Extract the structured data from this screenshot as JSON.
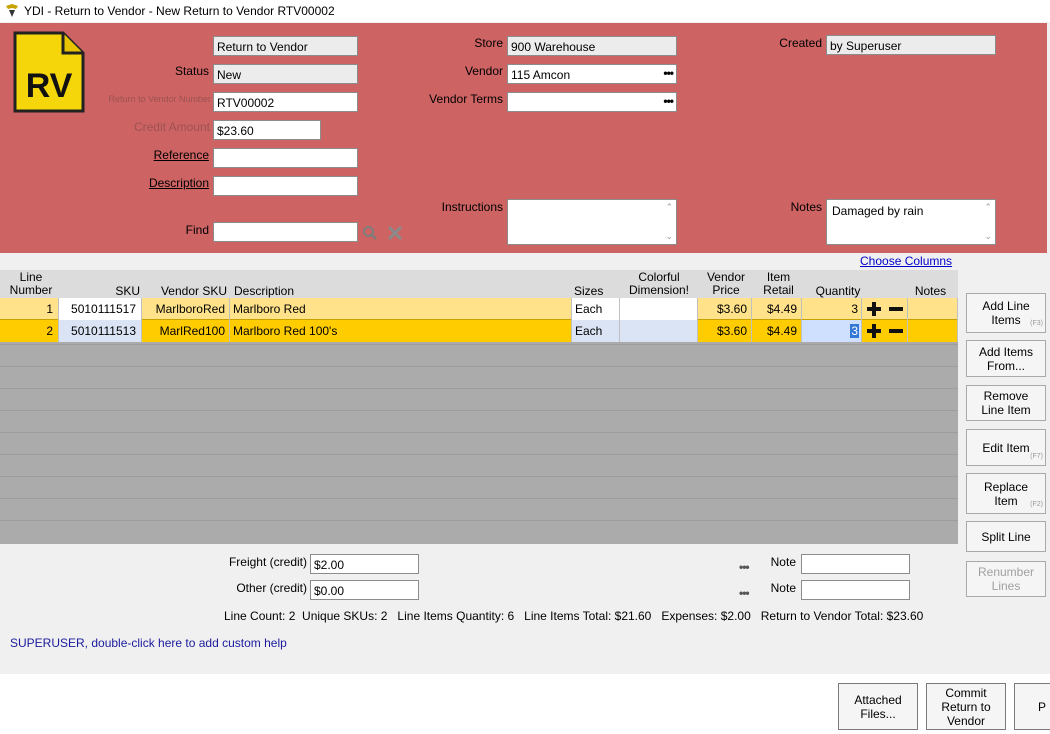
{
  "window": {
    "title": "YDI - Return to Vendor - New Return to Vendor RTV00002"
  },
  "header": {
    "type_value": "Return to Vendor",
    "status_label": "Status",
    "status_value": "New",
    "rtv_number_label": "Return to Vendor Number",
    "rtv_number_value": "RTV00002",
    "credit_amount_label": "Credit Amount",
    "credit_amount_value": "$23.60",
    "reference_label": "Reference",
    "reference_value": "",
    "description_label": "Description",
    "description_value": "",
    "find_label": "Find",
    "find_value": "",
    "store_label": "Store",
    "store_value": "900 Warehouse",
    "vendor_label": "Vendor",
    "vendor_value": "115 Amcon",
    "vendor_terms_label": "Vendor Terms",
    "vendor_terms_value": "",
    "instructions_label": "Instructions",
    "instructions_value": "",
    "created_label": "Created",
    "created_value": "by Superuser",
    "notes_label": "Notes",
    "notes_value": "Damaged by rain",
    "logo_text": "RV",
    "ellipsis": "•••"
  },
  "grid": {
    "choose_columns": "Choose Columns",
    "columns": {
      "line_number": "Line\nNumber",
      "sku": "SKU",
      "vendor_sku": "Vendor SKU",
      "description": "Description",
      "sizes": "Sizes",
      "colorful": "Colorful\nDimension!",
      "vendor_price": "Vendor\nPrice",
      "item_retail": "Item\nRetail",
      "quantity": "Quantity",
      "notes": "Notes"
    },
    "rows": [
      {
        "line": "1",
        "sku": "5010111517",
        "vendor_sku": "MarlboroRed",
        "description": "Marlboro Red",
        "size": "Each",
        "colorful": "",
        "vendor_price": "$3.60",
        "item_retail": "$4.49",
        "quantity": "3",
        "notes": ""
      },
      {
        "line": "2",
        "sku": "5010111513",
        "vendor_sku": "MarlRed100",
        "description": "Marlboro Red 100's",
        "size": "Each",
        "colorful": "",
        "vendor_price": "$3.60",
        "item_retail": "$4.49",
        "quantity": "3",
        "notes": ""
      }
    ]
  },
  "side_buttons": {
    "add_line_items": "Add Line\nItems",
    "add_line_items_hotkey": "(F3)",
    "add_items_from": "Add Items\nFrom...",
    "remove_line_item": "Remove\nLine Item",
    "edit_item": "Edit Item",
    "edit_item_hotkey": "(F7)",
    "replace_item": "Replace\nItem",
    "replace_item_hotkey": "(F2)",
    "split_line": "Split Line",
    "renumber_lines": "Renumber\nLines"
  },
  "totals": {
    "freight_label": "Freight (credit)",
    "freight_value": "$2.00",
    "other_label": "Other (credit)",
    "other_value": "$0.00",
    "note_label": "Note",
    "note1_value": "",
    "note2_value": "",
    "summary": "Line Count: 2  Unique SKUs: 2   Line Items Quantity: 6   Line Items Total: $21.60   Expenses: $2.00   Return to Vendor Total: $23.60"
  },
  "help_text": "SUPERUSER, double-click here to add custom help",
  "bottom_buttons": {
    "attached_files": "Attached\nFiles...",
    "commit": "Commit\nReturn to\nVendor",
    "partial": "P"
  },
  "colors": {
    "header_bg": "#cd6363",
    "row1_bg": "#ffe28a",
    "row2_bg": "#ffcc00",
    "logo_yellow": "#f5d60a"
  }
}
